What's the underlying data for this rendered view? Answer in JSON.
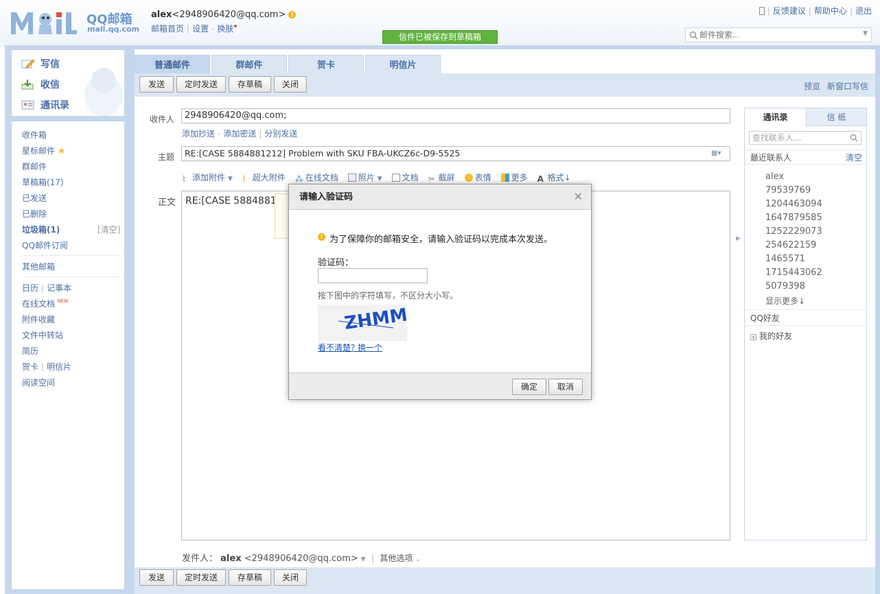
{
  "header": {
    "logo_qq": "QQ邮箱",
    "logo_url": "mail.qq.com",
    "user_name": "alex",
    "user_email": "<2948906420@qq.com>",
    "links": [
      "邮箱首页",
      "设置",
      "换肤"
    ],
    "saved_banner": "信件已被保存到草稿箱",
    "top_links": [
      "反馈建议",
      "帮助中心",
      "退出"
    ],
    "search_placeholder": "邮件搜索..."
  },
  "left_top": {
    "compose": "写信",
    "inbox": "收信",
    "contacts": "通讯录"
  },
  "left_nav": {
    "items": [
      "收件箱",
      "星标邮件",
      "群邮件",
      "草稿箱(17)",
      "已发送",
      "已删除",
      "垃圾箱(1)",
      "QQ邮件订阅"
    ],
    "clear": "[清空]",
    "other_mail": "其他邮箱",
    "calendar": "日历",
    "notebook": "记事本",
    "online_docs": "在线文档",
    "new_badge": "NEW",
    "attach_fav": "附件收藏",
    "file_transfer": "文件中转站",
    "resume": "简历",
    "card": "贺卡",
    "postcard": "明信片",
    "reading": "阅读空间"
  },
  "tabs": [
    "普通邮件",
    "群邮件",
    "贺卡",
    "明信片"
  ],
  "toolbar": {
    "send": "发送",
    "scheduled": "定时发送",
    "save_draft": "存草稿",
    "close": "关闭",
    "preview": "预览",
    "new_window": "新窗口写信"
  },
  "compose": {
    "to_label": "收件人",
    "to_value": "2948906420@qq.com;",
    "add_cc": "添加抄送",
    "add_bcc": "添加密送",
    "separate_send": "分别发送",
    "subject_label": "主题",
    "subject_value": "RE:[CASE 5884881212] Problem with SKU FBA-UKCZ6c-D9-5525",
    "attach_items": [
      "添加附件",
      "超大附件",
      "在线文档",
      "照片",
      "文档",
      "截屏",
      "表情",
      "更多",
      "格式↓"
    ],
    "body_label": "正文",
    "body_text": "RE:[CASE 58848812",
    "sender_label": "发件人：",
    "sender_name": "alex",
    "sender_email": "<2948906420@qq.com>",
    "other_options": "其他选项"
  },
  "contacts_panel": {
    "tabs": [
      "通讯录",
      "信 纸"
    ],
    "search_placeholder": "查找联系人...",
    "recent_title": "最近联系人",
    "clear": "清空",
    "recent": [
      "alex",
      "79539769",
      "1204463094",
      "1647879585",
      "1252229073",
      "254622159",
      "1465571",
      "1715443062",
      "5079398"
    ],
    "show_more": "显示更多↓",
    "qq_friends": "QQ好友",
    "my_friends": "我的好友"
  },
  "dialog": {
    "title": "请输入验证码",
    "message": "为了保障你的邮箱安全，请输入验证码以完成本次发送。",
    "code_label": "验证码：",
    "hint": "按下图中的字符填写，不区分大小写。",
    "captcha_text": "ZHMM",
    "refresh": "看不清楚? 换一个",
    "ok": "确定",
    "cancel": "取消"
  },
  "colors": {
    "accent": "#4a6fa5",
    "frame": "#c5d7ec",
    "banner": "#5fb33d",
    "captcha": "#1b4fc0"
  }
}
